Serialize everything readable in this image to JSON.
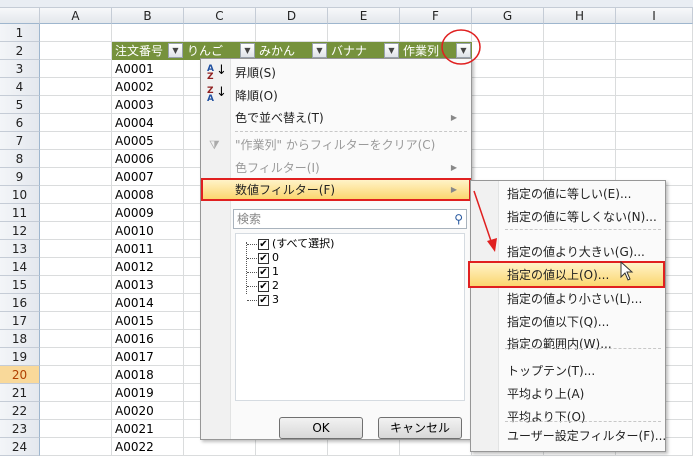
{
  "columns": [
    "A",
    "B",
    "C",
    "D",
    "E",
    "F",
    "G",
    "H",
    "I"
  ],
  "rows": [
    "1",
    "2",
    "3",
    "4",
    "5",
    "6",
    "7",
    "8",
    "9",
    "10",
    "11",
    "12",
    "13",
    "14",
    "15",
    "16",
    "17",
    "18",
    "19",
    "20",
    "21",
    "22",
    "23",
    "24"
  ],
  "selected_row": "20",
  "header_row": [
    "注文番号",
    "りんご",
    "みかん",
    "バナナ",
    "作業列"
  ],
  "column_b": [
    "A0001",
    "A0002",
    "A0003",
    "A0004",
    "A0005",
    "A0006",
    "A0007",
    "A0008",
    "A0009",
    "A0010",
    "A0011",
    "A0012",
    "A0013",
    "A0014",
    "A0015",
    "A0016",
    "A0017",
    "A0018",
    "A0019",
    "A0020",
    "A0021",
    "A0022"
  ],
  "menu": {
    "sort_asc": "昇順(S)",
    "sort_desc": "降順(O)",
    "sort_color": "色で並べ替え(T)",
    "clear_filter": "\"作業列\" からフィルターをクリア(C)",
    "color_filter": "色フィルター(I)",
    "number_filter": "数値フィルター(F)",
    "search_placeholder": "検索",
    "list": [
      "(すべて選択)",
      "0",
      "1",
      "2",
      "3"
    ],
    "ok": "OK",
    "cancel": "キャンセル"
  },
  "submenu": [
    "指定の値に等しい(E)...",
    "指定の値に等しくない(N)...",
    "指定の値より大きい(G)...",
    "指定の値以上(O)...",
    "指定の値より小さい(L)...",
    "指定の値以下(Q)...",
    "指定の範囲内(W)...",
    "トップテン(T)...",
    "平均より上(A)",
    "平均より下(O)",
    "ユーザー設定フィルター(F)..."
  ],
  "colors": {
    "header_green": "#76923c",
    "highlight_red": "#e02020"
  }
}
